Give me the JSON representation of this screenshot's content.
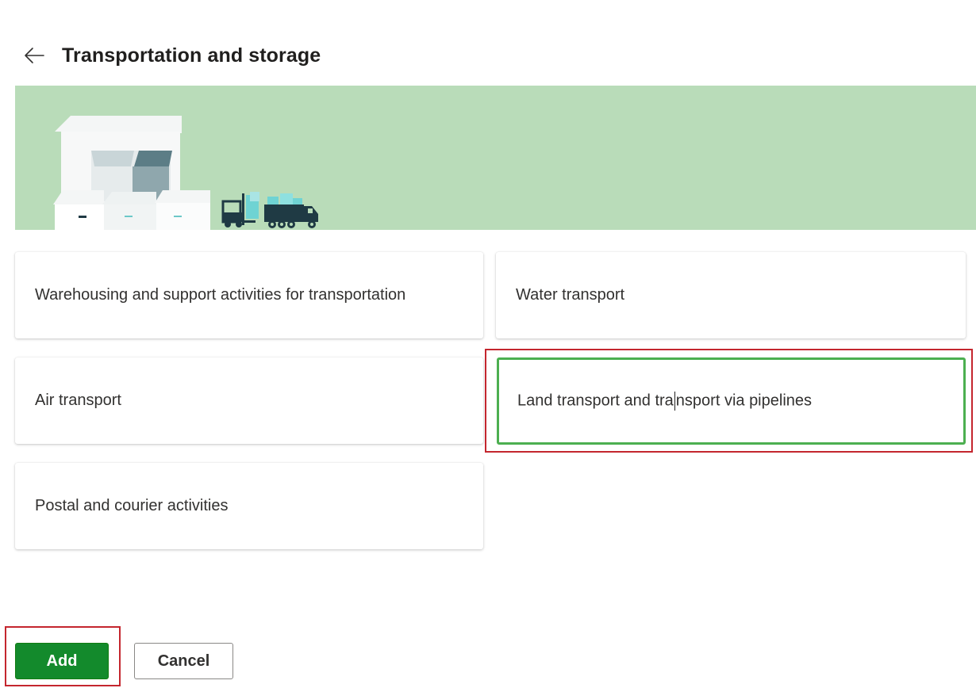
{
  "header": {
    "back_icon": "arrow-left-icon",
    "title": "Transportation and storage"
  },
  "banner": {
    "background_color": "#b9dcb9",
    "illustration": "warehouse-boxes-forklift-truck-illustration"
  },
  "cards": [
    {
      "label": "Warehousing and support activities for transportation",
      "selected": false
    },
    {
      "label": "Water transport",
      "selected": false
    },
    {
      "label": "Air transport",
      "selected": false
    },
    {
      "label_before_caret": "Land transport and tra",
      "label_after_caret": "nsport via pipelines",
      "selected": true
    },
    {
      "label": "Postal and courier activities",
      "selected": false
    }
  ],
  "actions": {
    "add_label": "Add",
    "cancel_label": "Cancel"
  },
  "colors": {
    "primary": "#138a2c",
    "selected_border": "#4caf50",
    "highlight": "#c4262e"
  }
}
